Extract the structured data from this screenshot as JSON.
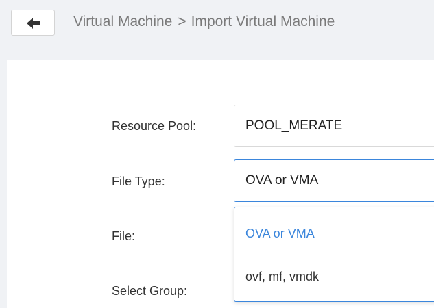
{
  "header": {
    "breadcrumb": {
      "parent": "Virtual Machine",
      "separator": ">",
      "current": "Import Virtual Machine"
    },
    "back_icon": "arrow-left-icon"
  },
  "form": {
    "resource_pool": {
      "label": "Resource Pool:",
      "value": "POOL_MERATE"
    },
    "file_type": {
      "label": "File Type:",
      "value": "OVA or VMA",
      "options": [
        "OVA or VMA",
        "ovf, mf, vmdk"
      ],
      "selected_option": "OVA or VMA"
    },
    "file": {
      "label": "File:"
    },
    "select_group": {
      "label": "Select Group:"
    }
  },
  "colors": {
    "accent": "#3b86dc",
    "header_background": "#f0f2f5",
    "panel_background": "#ffffff",
    "breadcrumb_text": "#7a7a7a"
  }
}
